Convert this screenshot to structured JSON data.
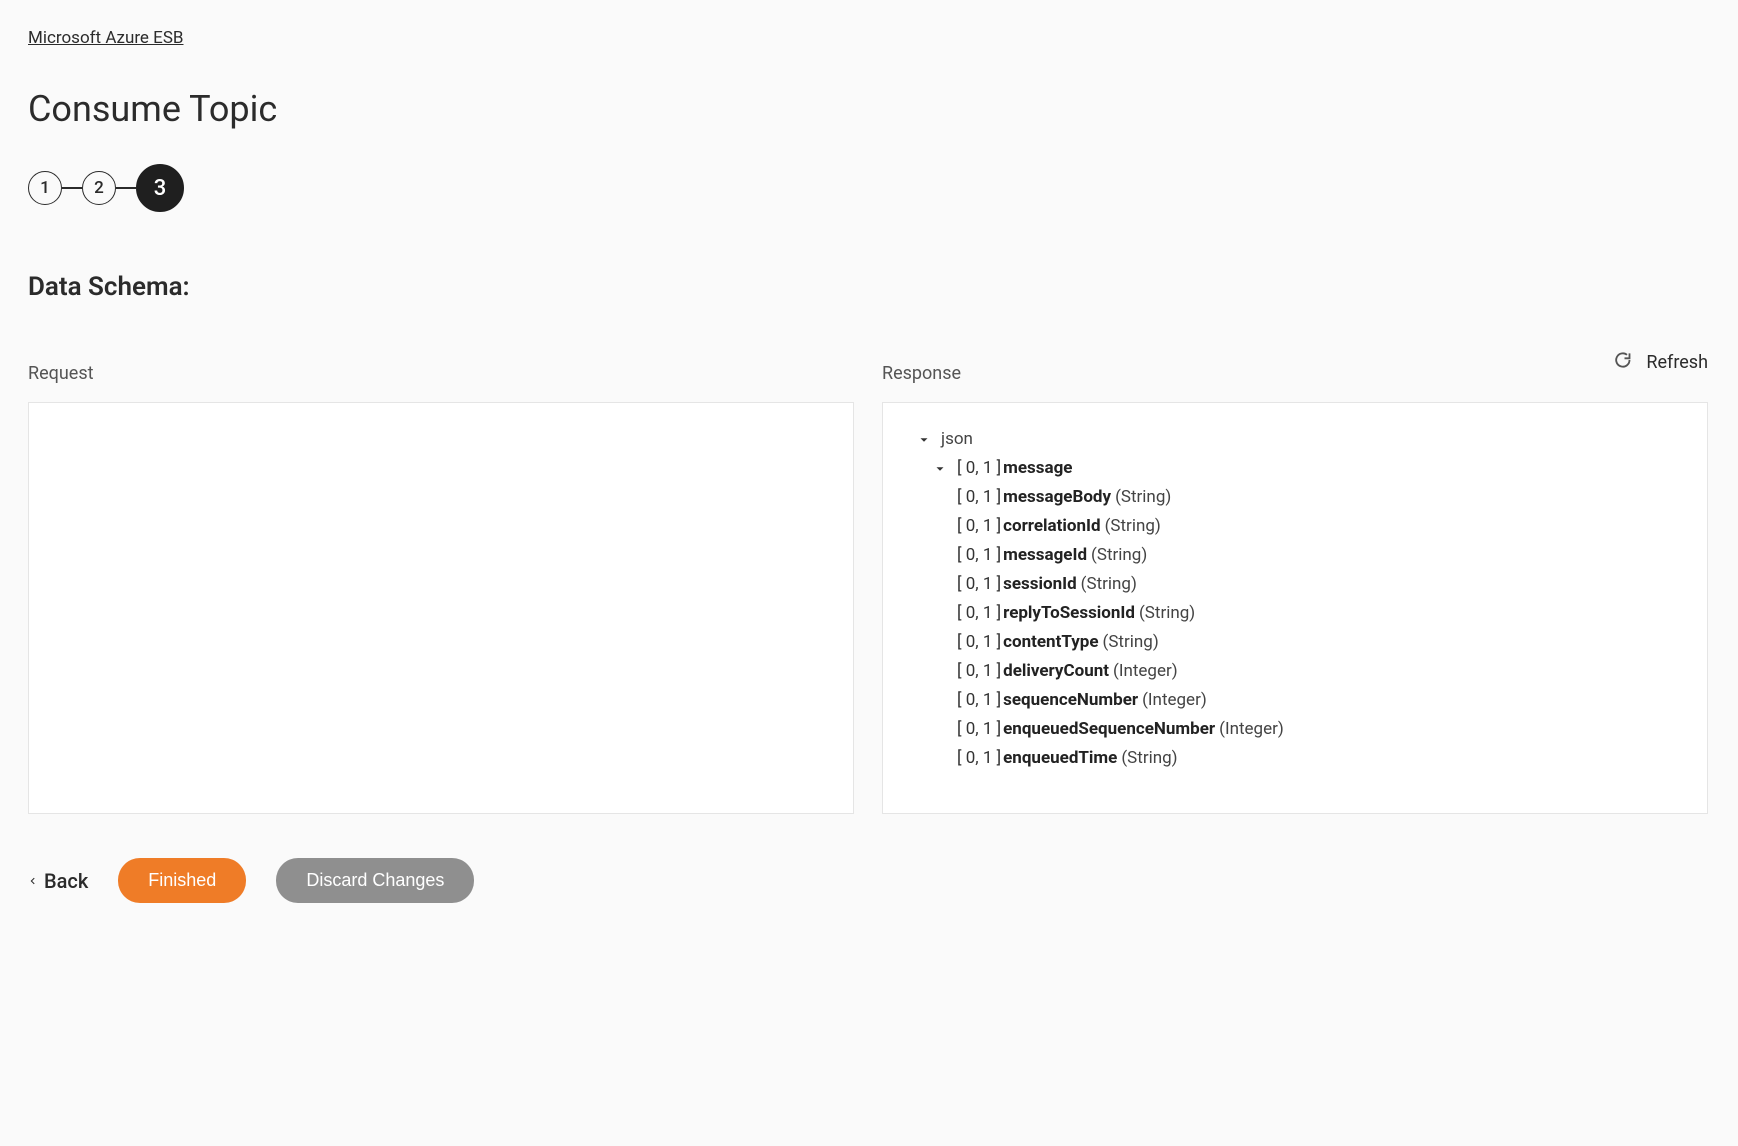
{
  "breadcrumb": "Microsoft Azure ESB",
  "pageTitle": "Consume Topic",
  "stepper": {
    "s1": "1",
    "s2": "2",
    "s3": "3"
  },
  "sectionLabel": "Data Schema:",
  "refreshLabel": "Refresh",
  "request": {
    "label": "Request"
  },
  "response": {
    "label": "Response",
    "root": "json",
    "messageCardinality": "[ 0, 1 ] ",
    "messageName": "message",
    "fields": [
      {
        "card": "[ 0, 1 ] ",
        "name": "messageBody",
        "type": "(String)"
      },
      {
        "card": "[ 0, 1 ] ",
        "name": "correlationId",
        "type": "(String)"
      },
      {
        "card": "[ 0, 1 ] ",
        "name": "messageId",
        "type": "(String)"
      },
      {
        "card": "[ 0, 1 ] ",
        "name": "sessionId",
        "type": "(String)"
      },
      {
        "card": "[ 0, 1 ] ",
        "name": "replyToSessionId",
        "type": "(String)"
      },
      {
        "card": "[ 0, 1 ] ",
        "name": "contentType",
        "type": "(String)"
      },
      {
        "card": "[ 0, 1 ] ",
        "name": "deliveryCount",
        "type": "(Integer)"
      },
      {
        "card": "[ 0, 1 ] ",
        "name": "sequenceNumber",
        "type": "(Integer)"
      },
      {
        "card": "[ 0, 1 ] ",
        "name": "enqueuedSequenceNumber",
        "type": "(Integer)"
      },
      {
        "card": "[ 0, 1 ] ",
        "name": "enqueuedTime",
        "type": "(String)"
      }
    ]
  },
  "buttons": {
    "back": "Back",
    "finished": "Finished",
    "discard": "Discard Changes"
  }
}
